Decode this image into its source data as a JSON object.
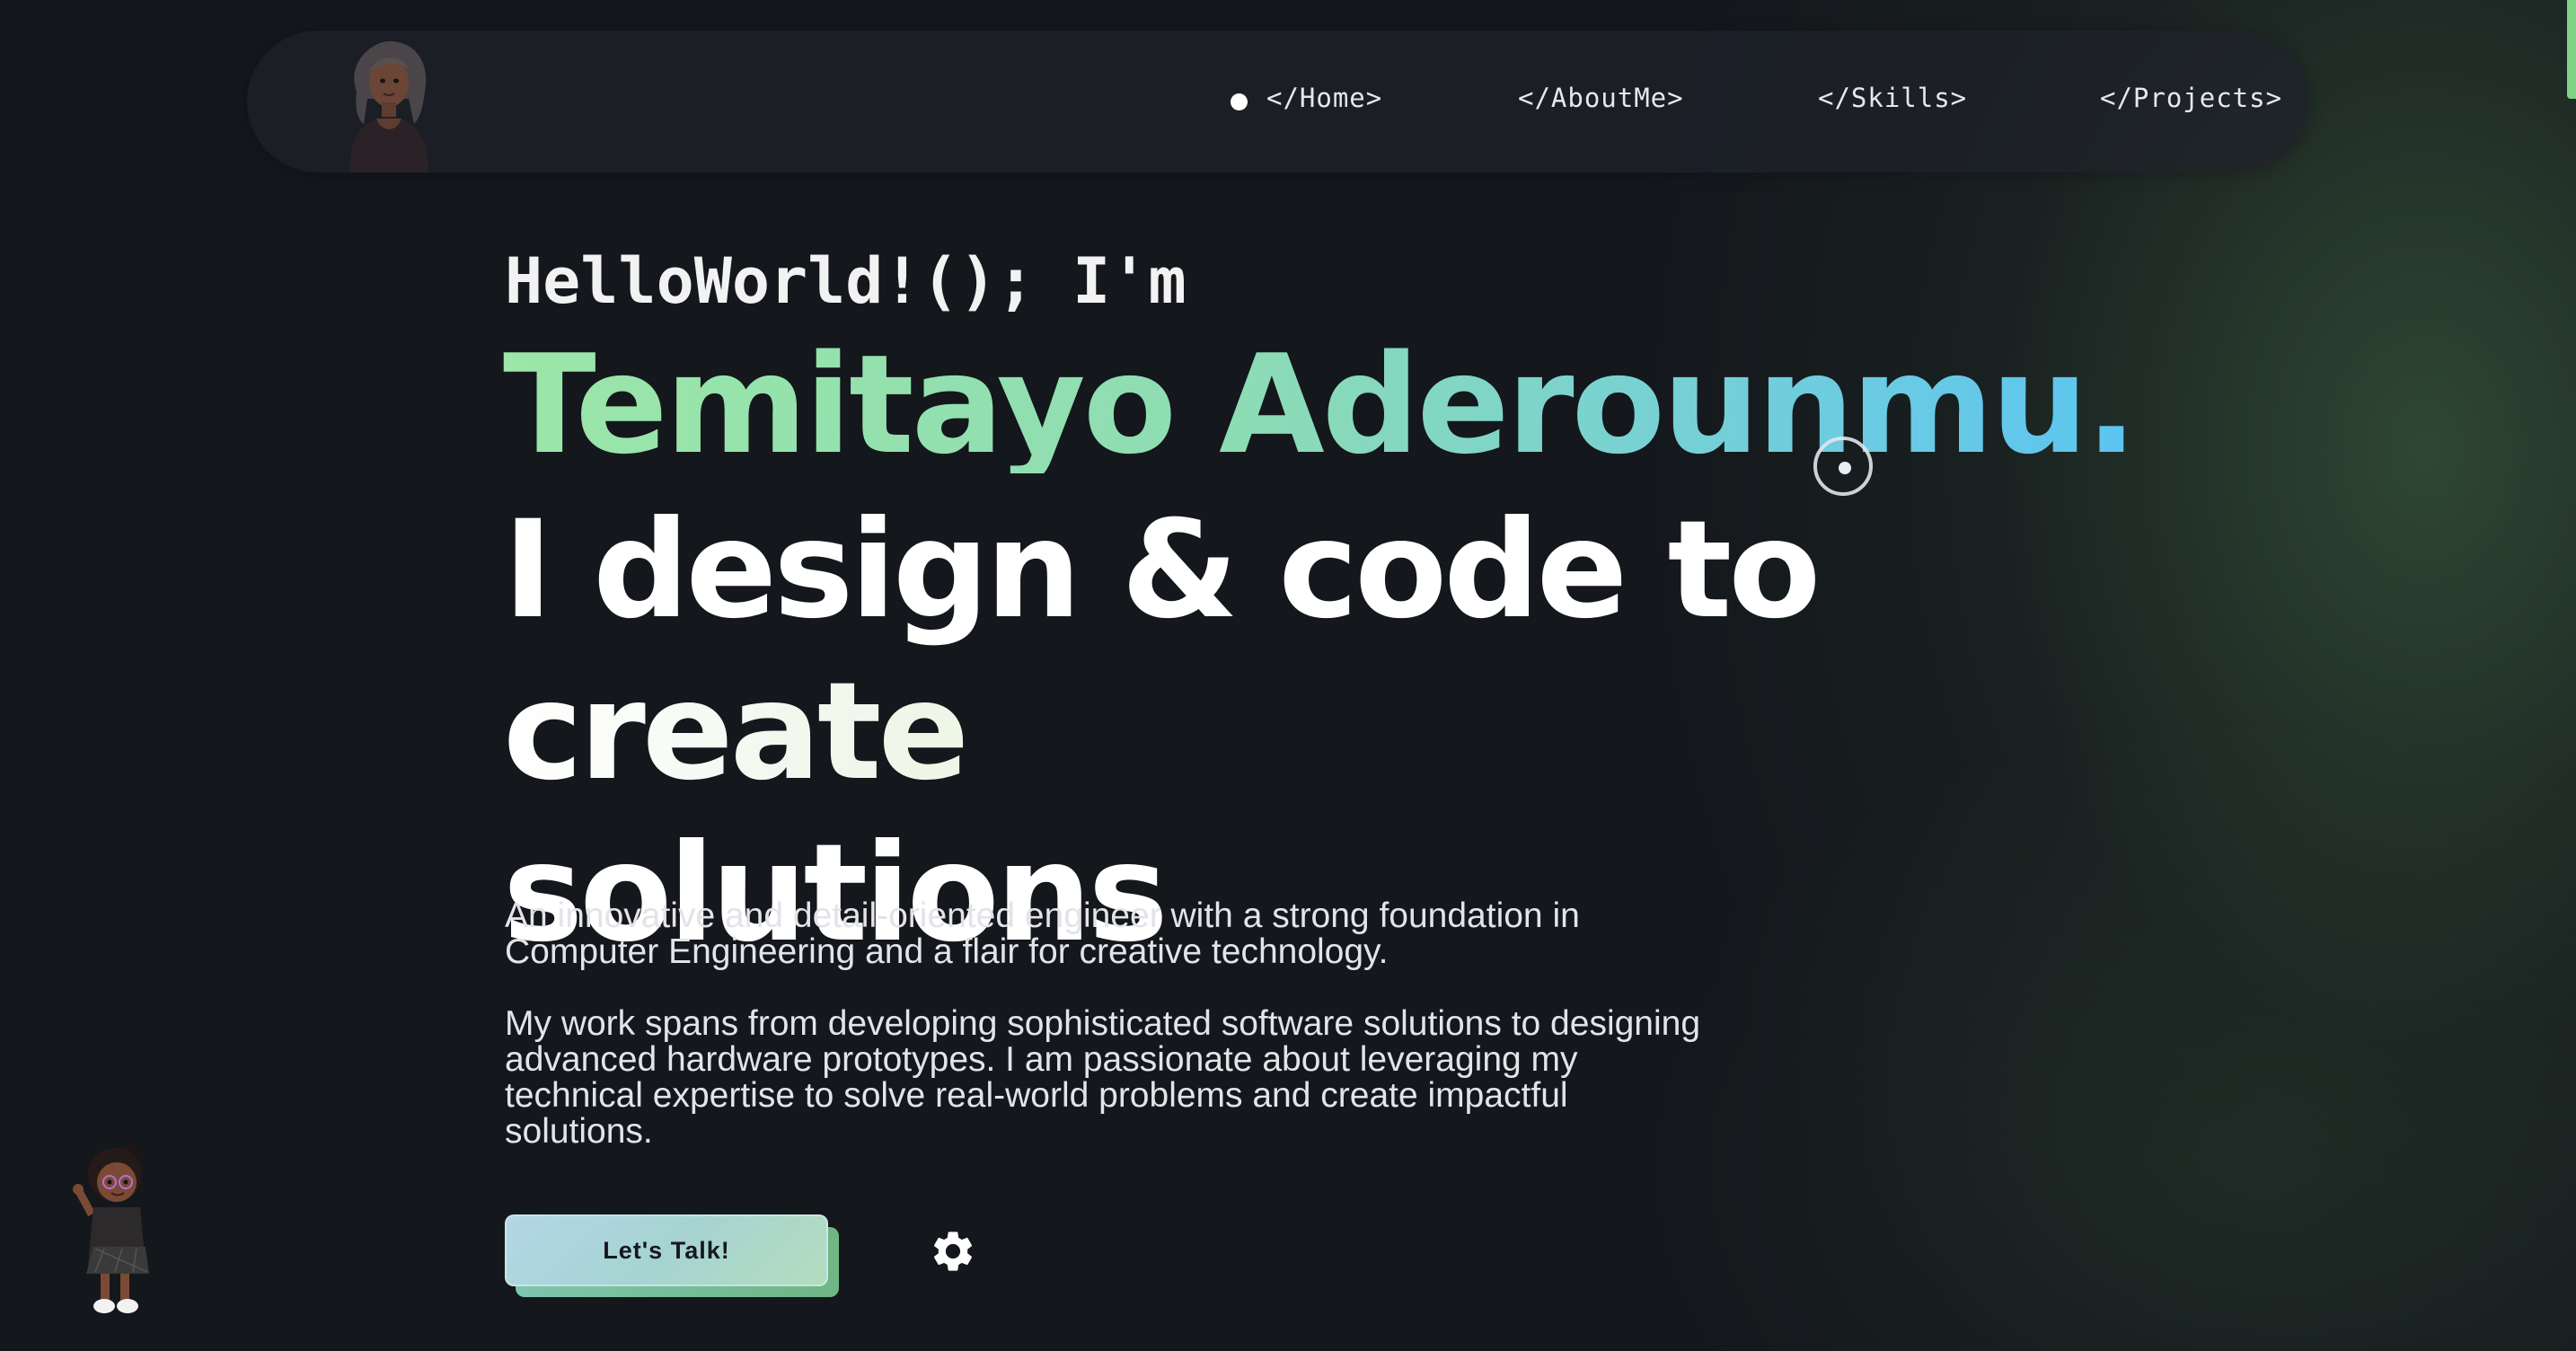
{
  "nav": {
    "items": [
      {
        "label": "</Home>",
        "active": true
      },
      {
        "label": "</AboutMe>",
        "active": false
      },
      {
        "label": "</Skills>",
        "active": false
      },
      {
        "label": "</Projects>",
        "active": false
      }
    ]
  },
  "hero": {
    "greeting": "HelloWorld!(); I'm",
    "name": "Temitayo Aderounmu.",
    "tagline_part1": "I design & code to ",
    "tagline_part2": "create",
    "tagline_part3": "solutions",
    "paragraph1": "An innovative and detail-oriented engineer with a strong foundation in Computer Engineering and a flair for creative technology.",
    "paragraph2": "My work spans from developing sophisticated software solutions to designing advanced hardware prototypes. I am passionate about leveraging my technical expertise to solve real-world problems and create impactful solutions."
  },
  "cta": {
    "label": "Let's Talk!"
  },
  "icons": {
    "settings": "gear-icon",
    "nav_avatar": "avatar-woman-illustration",
    "corner_avatar": "avatar-girl-waving-illustration",
    "cursor": "custom-cursor-ring"
  },
  "colors": {
    "background": "#14171c",
    "accent_green": "#9be6a8",
    "accent_blue": "#5bc4f0",
    "scrollbar": "#7ed286"
  }
}
